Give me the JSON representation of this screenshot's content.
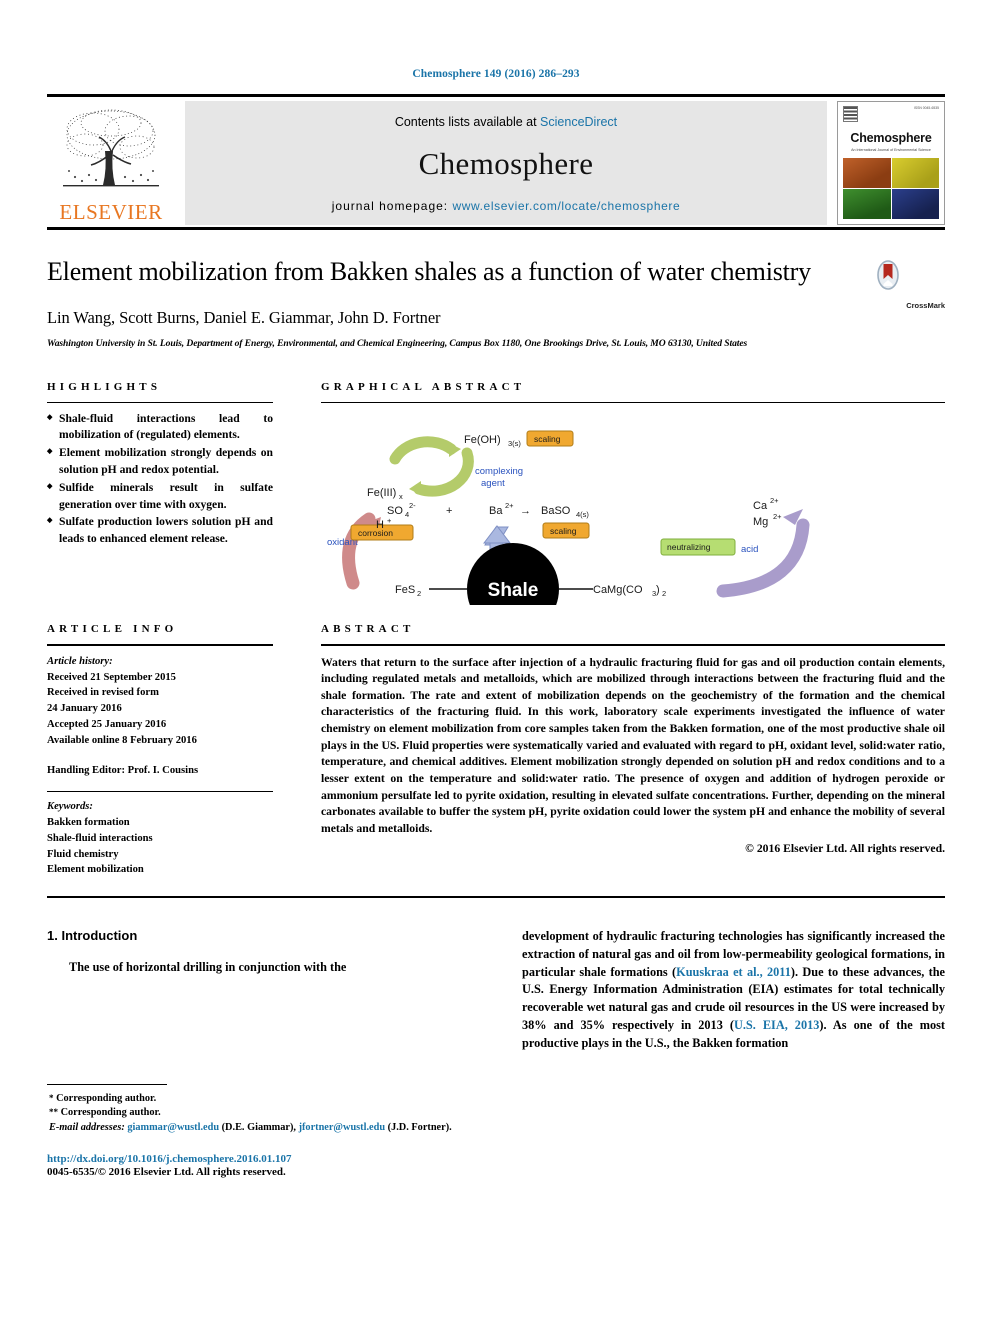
{
  "running_head": "Chemosphere 149 (2016) 286–293",
  "masthead": {
    "publisher": "ELSEVIER",
    "contents_prefix": "Contents lists available at ",
    "sciencedirect": "ScienceDirect",
    "journal_name": "Chemosphere",
    "homepage_prefix": "journal homepage: ",
    "homepage_url": "www.elsevier.com/locate/chemosphere",
    "cover": {
      "title": "Chemosphere",
      "subtitle": "An International Journal of Environmental Science",
      "issn": "ISSN 0045-6535"
    },
    "link_color": "#1a74a8"
  },
  "article": {
    "title": "Element mobilization from Bakken shales as a function of water chemistry",
    "authors": "Lin Wang, Scott Burns, Daniel E. Giammar, John D. Fortner",
    "affiliation": "Washington University in St. Louis, Department of Energy, Environmental, and Chemical Engineering, Campus Box 1180, One Brookings Drive, St. Louis, MO 63130, United States",
    "crossmark_label": "CrossMark"
  },
  "highlights": {
    "heading": "HIGHLIGHTS",
    "items": [
      "Shale-fluid interactions lead to mobilization of (regulated) elements.",
      "Element mobilization strongly depends on solution pH and redox potential.",
      "Sulfide minerals result in sulfate generation over time with oxygen.",
      "Sulfate production lowers solution pH and leads to enhanced element release."
    ]
  },
  "graphical_abstract": {
    "heading": "GRAPHICAL ABSTRACT",
    "center_label": "Shale",
    "labels": {
      "fe_hydroxide": "Fe(OH)3(s)",
      "fe_iii": "Fe(III)x",
      "scaling_top": "scaling",
      "complexing_agent": "complexing agent",
      "sulfate": "SO4",
      "sulfate_charge": "2-",
      "proton": "H+",
      "plus": "+",
      "barium_ion": "Ba2+",
      "arrow": "→",
      "barium_sulfate": "BaSO4(s)",
      "scaling_mid": "scaling",
      "corrosion": "corrosion",
      "oxidant": "oxidant",
      "pyrite": "FeS2",
      "barium": "Ba",
      "dolomite": "CaMg(CO3)2",
      "calcium": "Ca2+",
      "magnesium": "Mg2+",
      "neutralizing": "neutralizing",
      "acid": "acid"
    },
    "colors": {
      "tag_orange": "#f0a830",
      "tag_green": "#b6dd72",
      "arrow_green": "#b4cb6a",
      "arrow_red": "#cf8a8a",
      "arrow_blue": "#aab8e0",
      "arrow_purple": "#a99ccb",
      "blue_text": "#2a52be"
    }
  },
  "article_info": {
    "heading": "ARTICLE INFO",
    "history_label": "Article history:",
    "history": [
      "Received 21 September 2015",
      "Received in revised form",
      "24 January 2016",
      "Accepted 25 January 2016",
      "Available online 8 February 2016"
    ],
    "handling_editor": "Handling Editor: Prof. I. Cousins",
    "keywords_label": "Keywords:",
    "keywords": [
      "Bakken formation",
      "Shale-fluid interactions",
      "Fluid chemistry",
      "Element mobilization"
    ]
  },
  "abstract": {
    "heading": "ABSTRACT",
    "text": "Waters that return to the surface after injection of a hydraulic fracturing fluid for gas and oil production contain elements, including regulated metals and metalloids, which are mobilized through interactions between the fracturing fluid and the shale formation. The rate and extent of mobilization depends on the geochemistry of the formation and the chemical characteristics of the fracturing fluid. In this work, laboratory scale experiments investigated the influence of water chemistry on element mobilization from core samples taken from the Bakken formation, one of the most productive shale oil plays in the US. Fluid properties were systematically varied and evaluated with regard to pH, oxidant level, solid:water ratio, temperature, and chemical additives. Element mobilization strongly depended on solution pH and redox conditions and to a lesser extent on the temperature and solid:water ratio. The presence of oxygen and addition of hydrogen peroxide or ammonium persulfate led to pyrite oxidation, resulting in elevated sulfate concentrations. Further, depending on the mineral carbonates available to buffer the system pH, pyrite oxidation could lower the system pH and enhance the mobility of several metals and metalloids.",
    "copyright": "© 2016 Elsevier Ltd. All rights reserved."
  },
  "introduction": {
    "heading": "1. Introduction",
    "left_paragraph": "The use of horizontal drilling in conjunction with the",
    "right_paragraph_part1": "development of hydraulic fracturing technologies has significantly increased the extraction of natural gas and oil from low-permeability geological formations, in particular shale formations (",
    "citation1": "Kuuskraa et al., 2011",
    "right_paragraph_part2": "). Due to these advances, the U.S. Energy Information Administration (EIA) estimates for total technically recoverable wet natural gas and crude oil resources in the US were increased by 38% and 35% respectively in 2013 (",
    "citation2": "U.S. EIA, 2013",
    "right_paragraph_part3": "). As one of the most productive plays in the U.S., the Bakken formation"
  },
  "footnotes": {
    "corresponding1": "Corresponding author.",
    "corresponding2": "Corresponding author.",
    "email_label": "E-mail addresses:",
    "email1": "giammar@wustl.edu",
    "email1_owner": "(D.E. Giammar),",
    "email2": "jfortner@wustl.edu",
    "email2_owner": "(J.D. Fortner).",
    "doi": "http://dx.doi.org/10.1016/j.chemosphere.2016.01.107",
    "issn_line": "0045-6535/© 2016 Elsevier Ltd. All rights reserved."
  }
}
